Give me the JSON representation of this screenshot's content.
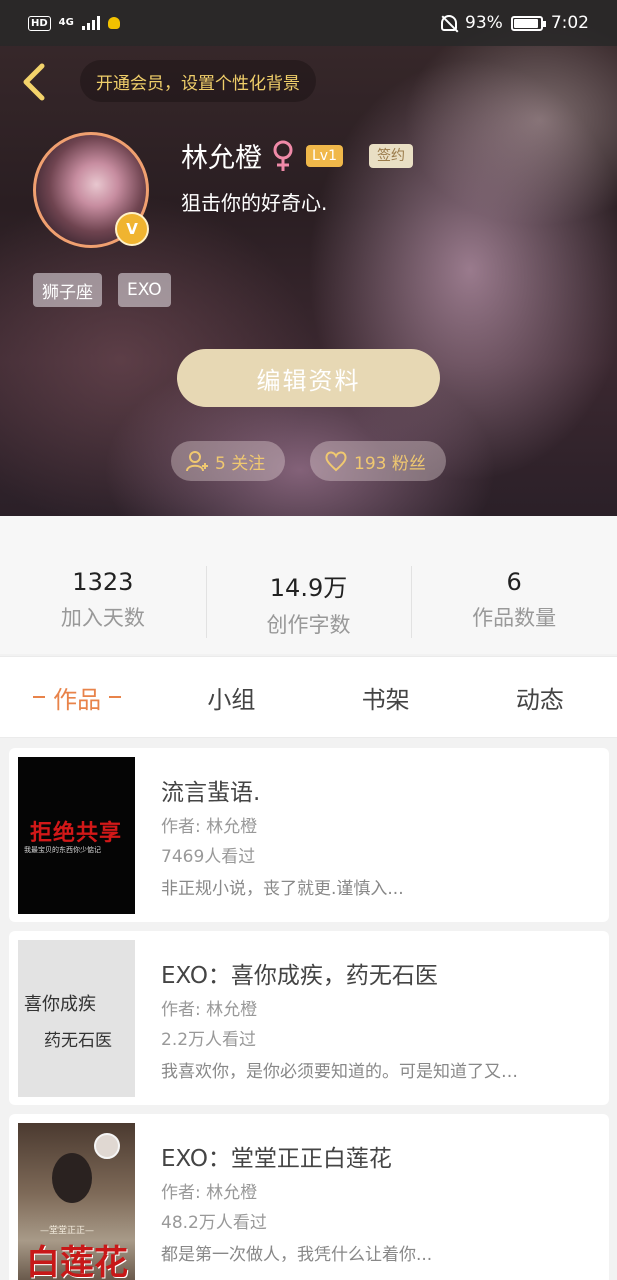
{
  "status_bar": {
    "hd": "HD",
    "network": "4G",
    "battery_text": "93%",
    "battery_level": 0.93,
    "time": "7:02"
  },
  "header": {
    "vip_prompt": "开通会员，设置个性化背景",
    "name": "林允橙",
    "gender": "female",
    "level": "Lv1",
    "signed_badge": "签约",
    "verified_badge": "V",
    "bio": "狙击你的好奇心.",
    "tags": [
      "狮子座",
      "EXO"
    ],
    "edit_button": "编辑资料",
    "following": "5 关注",
    "fans": "193 粉丝",
    "accent_color": "#f0c870"
  },
  "stats": [
    {
      "value": "1323",
      "label": "加入天数"
    },
    {
      "value": "14.9万",
      "label": "创作字数"
    },
    {
      "value": "6",
      "label": "作品数量"
    }
  ],
  "tabs": [
    {
      "label": "作品",
      "active": true
    },
    {
      "label": "小组",
      "active": false
    },
    {
      "label": "书架",
      "active": false
    },
    {
      "label": "动态",
      "active": false
    }
  ],
  "works": [
    {
      "title": "流言蜚语.",
      "author": "作者: 林允橙",
      "views": "7469人看过",
      "desc": "非正规小说，丧了就更.谨慎入...",
      "cover_text": "拒绝共享",
      "cover_subtext": "我最宝贝的东西你少惦记"
    },
    {
      "title": "EXO：喜你成疾，药无石医",
      "author": "作者: 林允橙",
      "views": "2.2万人看过",
      "desc": "我喜欢你，是你必须要知道的。可是知道了又…",
      "cover_text": "喜你成疾",
      "cover_subtext": "药无石医"
    },
    {
      "title": "EXO：堂堂正正白莲花",
      "author": "作者: 林允橙",
      "views": "48.2万人看过",
      "desc": "都是第一次做人，我凭什么让着你...",
      "cover_text": "白莲花",
      "cover_subtext": "—堂堂正正—"
    }
  ]
}
